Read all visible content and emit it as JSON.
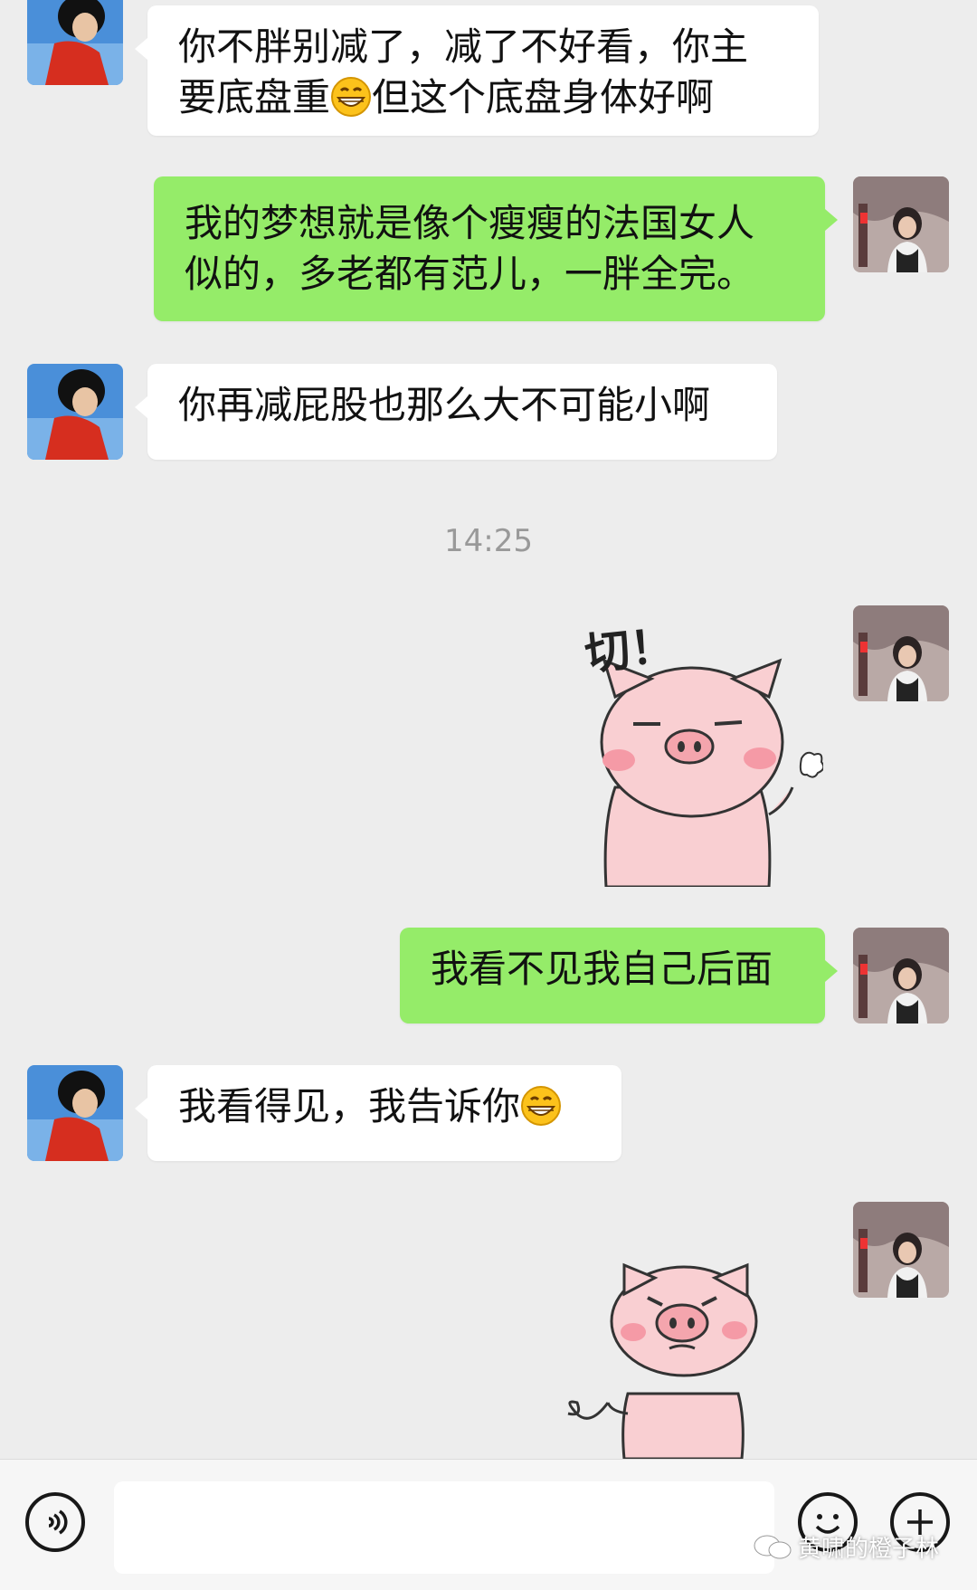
{
  "messages": [
    {
      "side": "in",
      "lines": [
        "你不胖别减了，减了不好看，你主",
        "要底盘重",
        "但这个底盘身体好啊"
      ],
      "emoji": "grin-emoji"
    },
    {
      "side": "out",
      "lines": [
        "我的梦想就是像个瘦瘦的法国女人",
        "似的，多老都有范儿，一胖全完。"
      ]
    },
    {
      "side": "in",
      "text": "你再减屁股也那么大不可能小啊"
    },
    {
      "side": "out",
      "text": "我看不见我自己后面"
    },
    {
      "side": "in",
      "text": "我看得见，我告诉你",
      "emoji": "grin-emoji"
    }
  ],
  "timestamp": "14:25",
  "stickers": [
    {
      "name": "pig-sticker-qie",
      "caption": "切！"
    },
    {
      "name": "pig-sticker-whip"
    }
  ],
  "input_bar": {
    "voice_icon": "voice-icon",
    "emoji_icon": "emoji-icon",
    "plus_icon": "plus-icon",
    "input_value": ""
  },
  "watermark": "黄啸的橙子林",
  "colors": {
    "outgoing_bubble": "#95ec69",
    "incoming_bubble": "#ffffff",
    "background": "#ededed"
  }
}
